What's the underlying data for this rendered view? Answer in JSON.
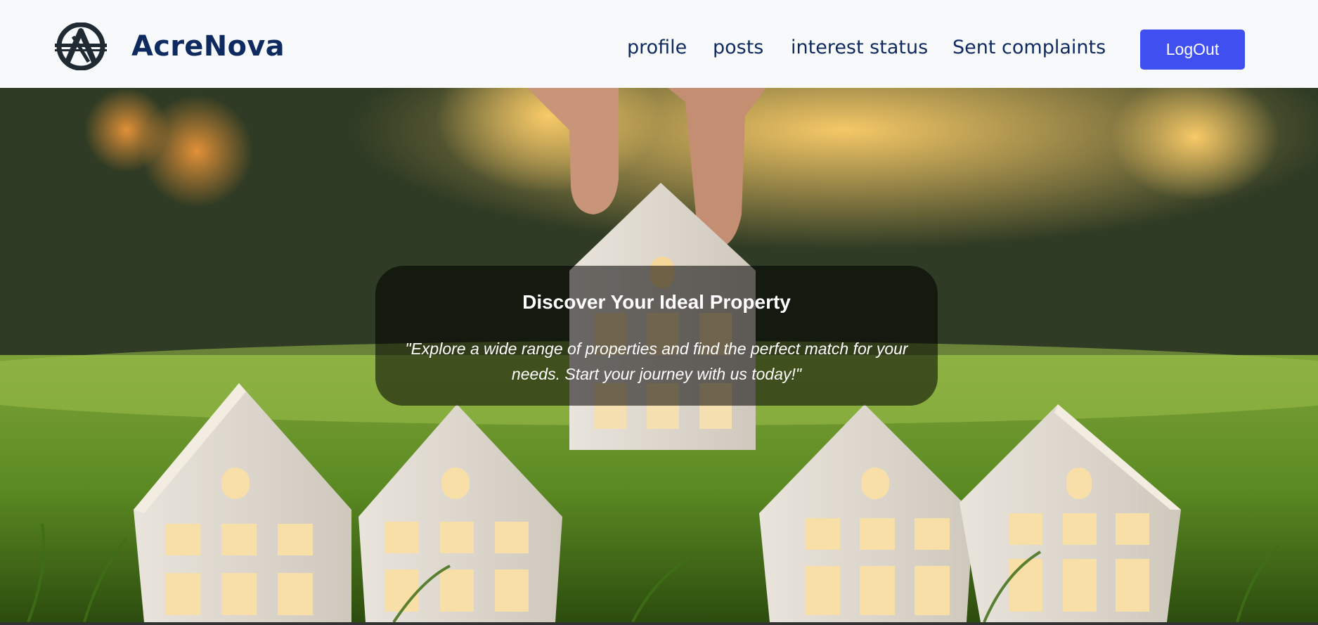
{
  "brand": {
    "name": "AcreNova",
    "logo_icon": "acrenova-logo-icon"
  },
  "nav": {
    "profile": "profile",
    "posts": "posts",
    "interest_status": "interest status",
    "sent_complaints": "Sent complaints",
    "logout": "LogOut"
  },
  "hero": {
    "title": "Discover Your Ideal Property",
    "text": "\"Explore a wide range of properties and find the perfect match for your needs. Start your journey with us today!\""
  },
  "colors": {
    "brand_navy": "#0e2a5e",
    "logout_button": "#4050f0",
    "navbar_bg": "#f8f9fa"
  }
}
